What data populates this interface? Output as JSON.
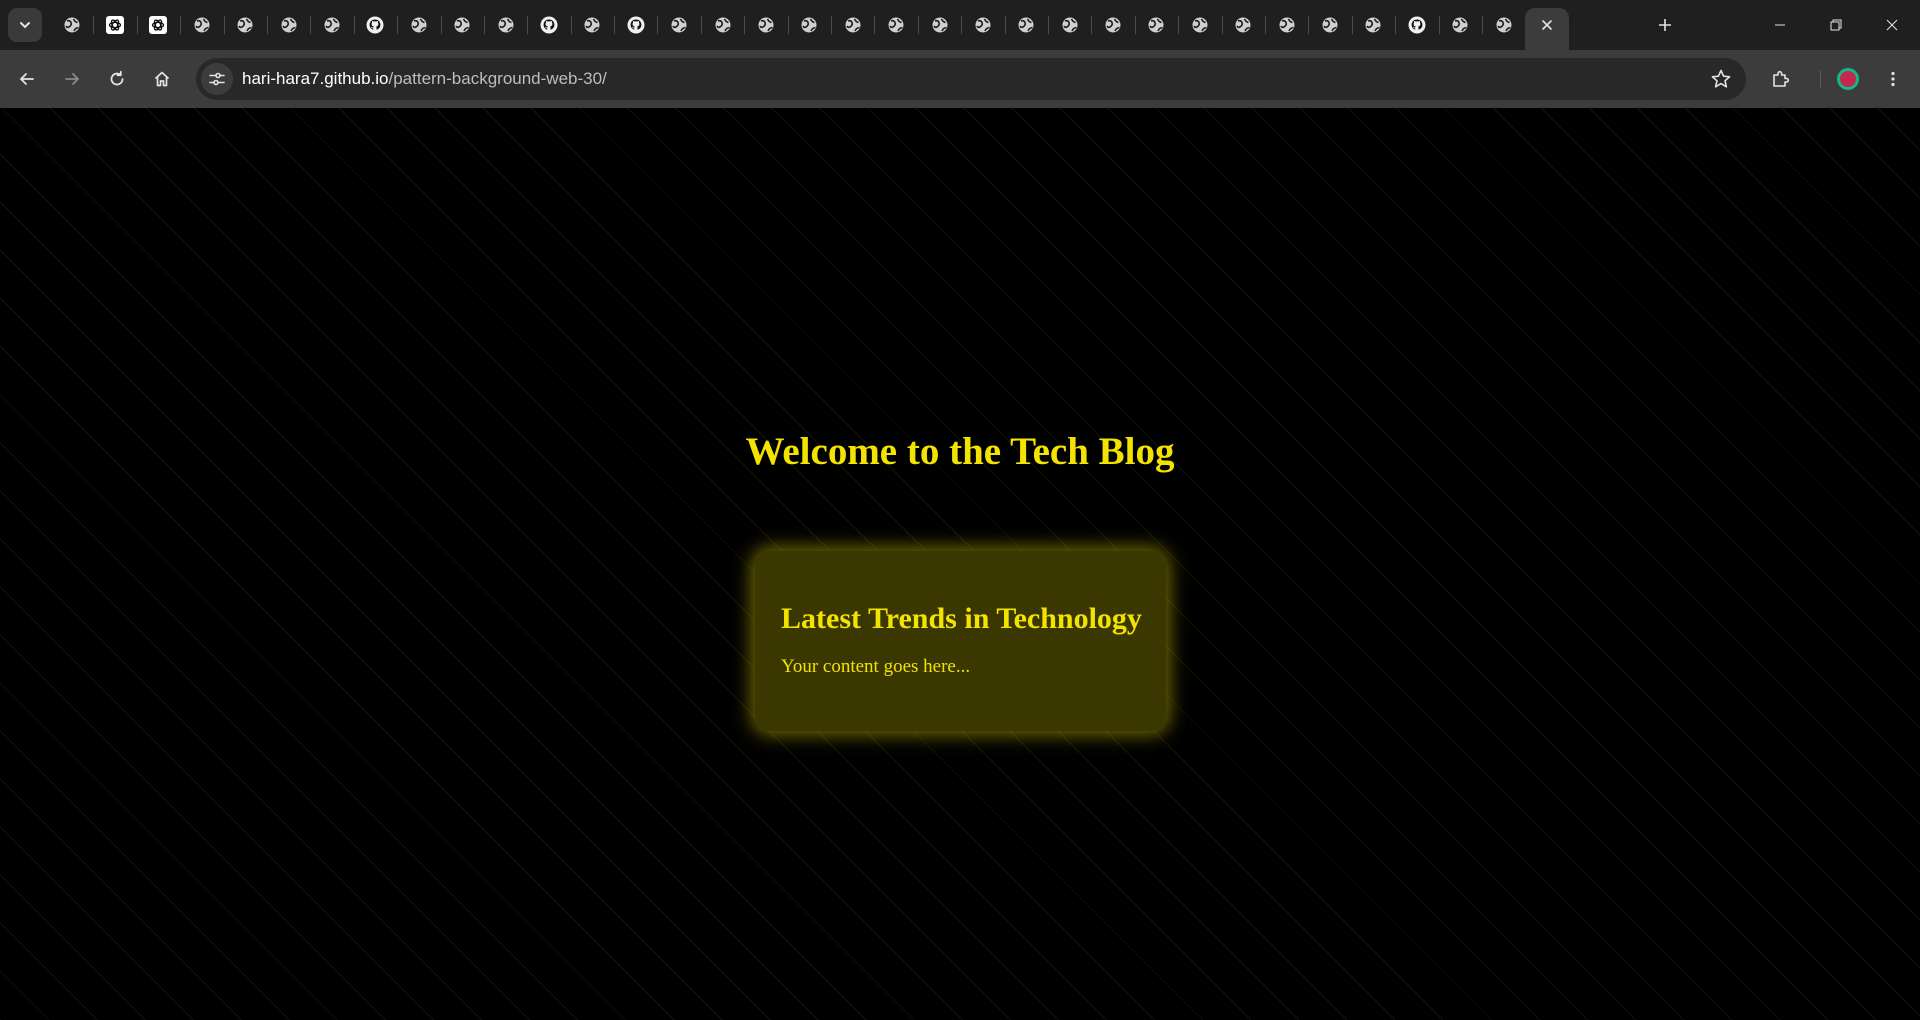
{
  "browser": {
    "tab_favicons": [
      "globe-icon",
      "openai-icon",
      "openai-icon",
      "globe-icon",
      "globe-icon",
      "globe-icon",
      "globe-icon",
      "github-icon",
      "globe-icon",
      "globe-icon",
      "globe-icon",
      "github-icon",
      "globe-icon",
      "github-icon",
      "globe-icon",
      "globe-icon",
      "globe-icon",
      "globe-icon",
      "globe-icon",
      "globe-icon",
      "globe-icon",
      "globe-icon",
      "globe-icon",
      "globe-icon",
      "globe-icon",
      "globe-icon",
      "globe-icon",
      "globe-icon",
      "globe-icon",
      "globe-icon",
      "globe-icon",
      "github-icon",
      "globe-icon",
      "globe-icon",
      "close-icon"
    ],
    "active_tab_index": 34,
    "url_host": "hari-hara7.github.io",
    "url_path": "/pattern-background-web-30/",
    "profile_colors": {
      "fill": "#c8264f",
      "ring": "#12b886"
    }
  },
  "page": {
    "title": "Welcome to the Tech Blog",
    "card": {
      "heading": "Latest Trends in Technology",
      "body": "Your content goes here..."
    },
    "colors": {
      "background": "#000000",
      "accent_text": "#f2e300",
      "card_background": "#3a3800",
      "stripe": "#ffd700"
    }
  }
}
